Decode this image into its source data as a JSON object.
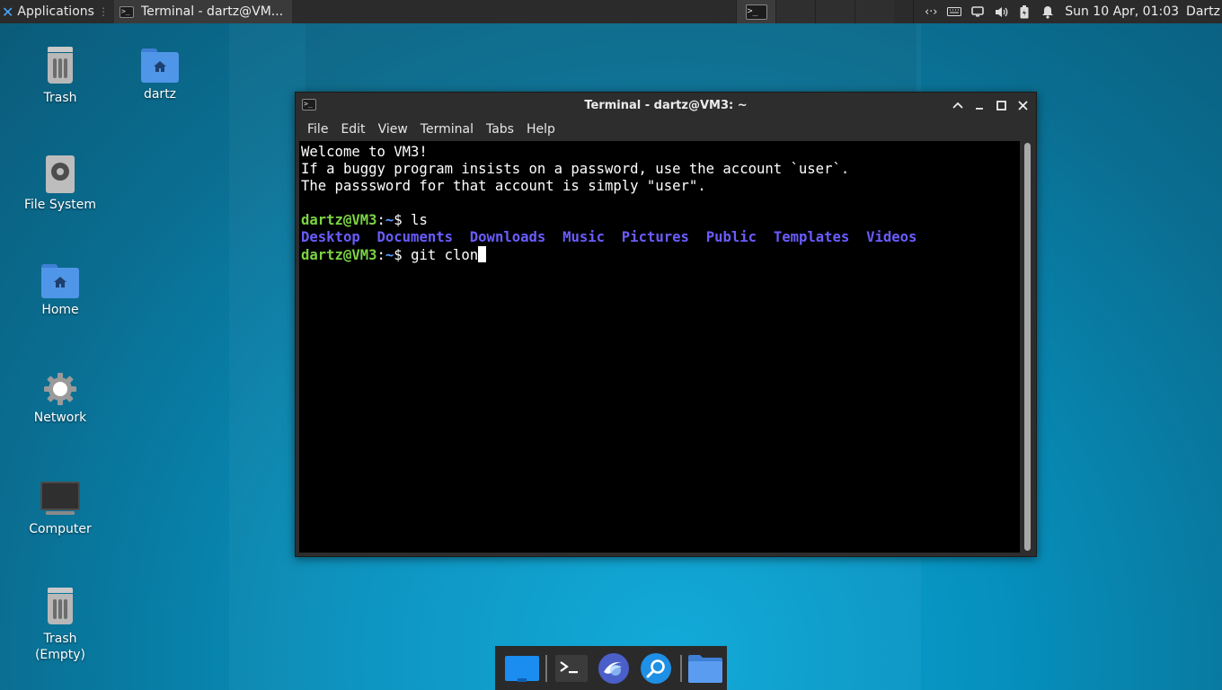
{
  "top_panel": {
    "applications_label": "Applications",
    "task_label": "Terminal - dartz@VM...",
    "clock": "Sun 10 Apr, 01:03",
    "user": "Dartz",
    "workspaces": [
      "terminal",
      "",
      "",
      ""
    ]
  },
  "desktop_icons": [
    {
      "name": "trash",
      "label": "Trash"
    },
    {
      "name": "dartz-home",
      "label": "dartz"
    },
    {
      "name": "file-system",
      "label": "File System"
    },
    {
      "name": "home",
      "label": "Home"
    },
    {
      "name": "network",
      "label": "Network"
    },
    {
      "name": "computer",
      "label": "Computer"
    },
    {
      "name": "trash-empty",
      "label": "Trash\n(Empty)"
    }
  ],
  "terminal": {
    "title": "Terminal - dartz@VM3: ~",
    "menu": [
      "File",
      "Edit",
      "View",
      "Terminal",
      "Tabs",
      "Help"
    ],
    "motd": [
      "Welcome to VM3!",
      "If a buggy program insists on a password, use the account `user`.",
      "The passsword for that account is simply \"user\"."
    ],
    "prompt_user": "dartz@VM3",
    "prompt_colon": ":",
    "prompt_path": "~",
    "prompt_dollar": "$ ",
    "command1": "ls",
    "ls_output": [
      "Desktop",
      "Documents",
      "Downloads",
      "Music",
      "Pictures",
      "Public",
      "Templates",
      "Videos"
    ],
    "command2": "git clon"
  },
  "dock": {
    "items": [
      "show-desktop",
      "terminal",
      "web-browser",
      "app-finder",
      "file-manager"
    ]
  },
  "colors": {
    "prompt_user": "#7bd343",
    "prompt_path": "#5b9cff",
    "directory": "#6a5cff",
    "panel": "#2b2b2b"
  }
}
